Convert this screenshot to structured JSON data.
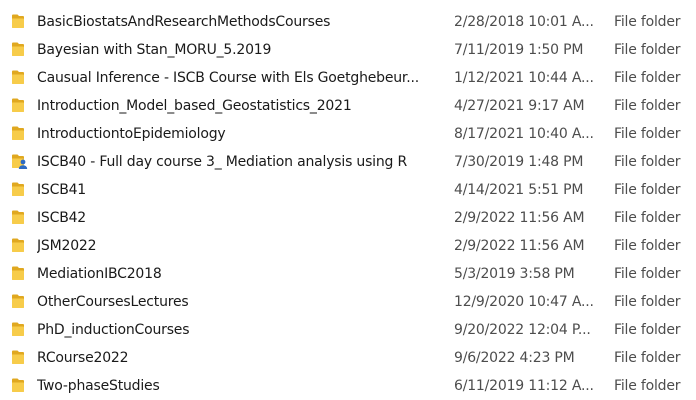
{
  "colors": {
    "folder_back": "#E0A820",
    "folder_front": "#F7CC4A",
    "shared_user": "#2D6BC4"
  },
  "files": [
    {
      "name": "BasicBiostatsAndResearchMethodsCourses",
      "date": "2/28/2018 10:01 A...",
      "type": "File folder",
      "icon": "folder-icon"
    },
    {
      "name": "Bayesian with Stan_MORU_5.2019",
      "date": "7/11/2019 1:50 PM",
      "type": "File folder",
      "icon": "folder-icon"
    },
    {
      "name": "Causual Inference - ISCB Course with Els Goetghebeur...",
      "date": "1/12/2021 10:44 A...",
      "type": "File folder",
      "icon": "folder-icon"
    },
    {
      "name": "Introduction_Model_based_Geostatistics_2021",
      "date": "4/27/2021 9:17 AM",
      "type": "File folder",
      "icon": "folder-icon"
    },
    {
      "name": "IntroductiontoEpidemiology",
      "date": "8/17/2021 10:40 A...",
      "type": "File folder",
      "icon": "folder-icon"
    },
    {
      "name": "ISCB40 - Full day course 3_ Mediation analysis using R",
      "date": "7/30/2019 1:48 PM",
      "type": "File folder",
      "icon": "shared-folder-icon"
    },
    {
      "name": "ISCB41",
      "date": "4/14/2021 5:51 PM",
      "type": "File folder",
      "icon": "folder-icon"
    },
    {
      "name": "ISCB42",
      "date": "2/9/2022 11:56 AM",
      "type": "File folder",
      "icon": "folder-icon"
    },
    {
      "name": "JSM2022",
      "date": "2/9/2022 11:56 AM",
      "type": "File folder",
      "icon": "folder-icon"
    },
    {
      "name": "MediationIBC2018",
      "date": "5/3/2019 3:58 PM",
      "type": "File folder",
      "icon": "folder-icon"
    },
    {
      "name": "OtherCoursesLectures",
      "date": "12/9/2020 10:47 A...",
      "type": "File folder",
      "icon": "folder-icon"
    },
    {
      "name": "PhD_inductionCourses",
      "date": "9/20/2022 12:04 P...",
      "type": "File folder",
      "icon": "folder-icon"
    },
    {
      "name": "RCourse2022",
      "date": "9/6/2022 4:23 PM",
      "type": "File folder",
      "icon": "folder-icon"
    },
    {
      "name": "Two-phaseStudies",
      "date": "6/11/2019 11:12 A...",
      "type": "File folder",
      "icon": "folder-icon"
    }
  ]
}
